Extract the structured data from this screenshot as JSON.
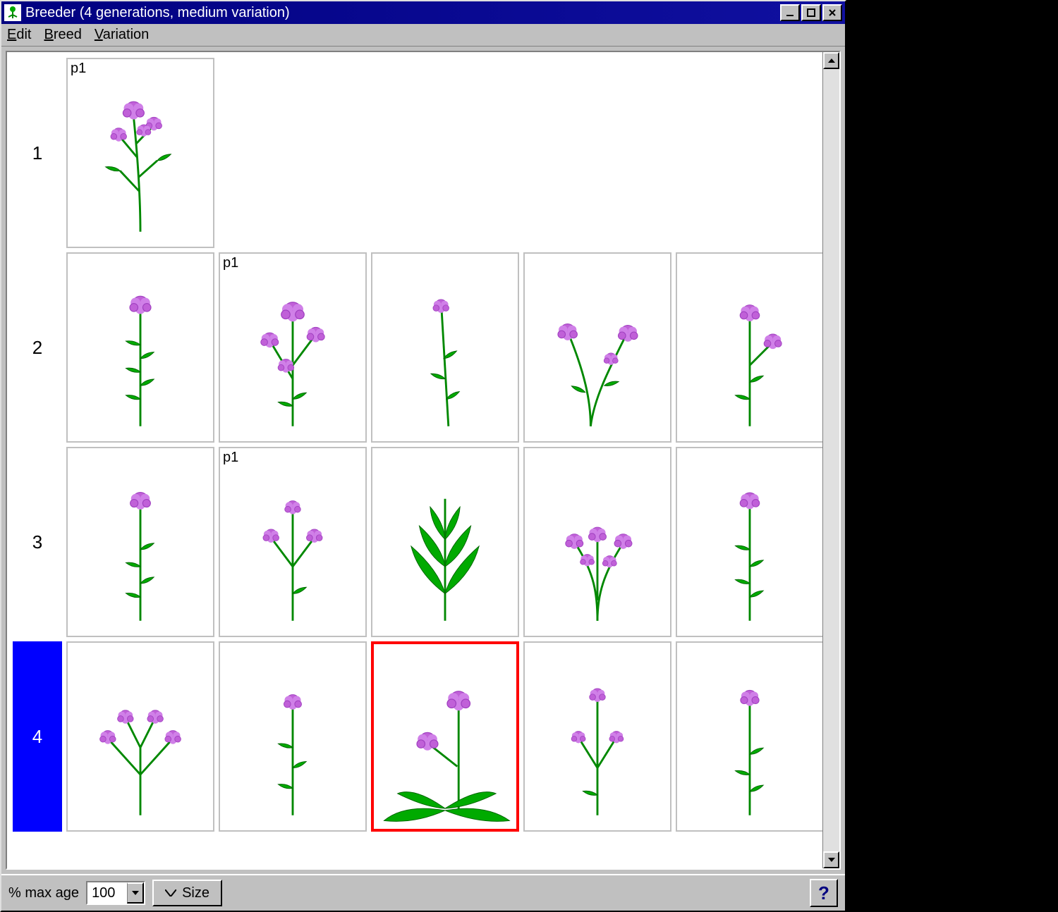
{
  "window": {
    "title": "Breeder (4 generations, medium variation)"
  },
  "menu": {
    "edit": "Edit",
    "breed": "Breed",
    "variation": "Variation"
  },
  "generations": [
    {
      "label": "1",
      "selected": false,
      "cells": [
        {
          "tag": "p1",
          "plant": "A",
          "selected": false
        },
        null,
        null,
        null,
        null
      ]
    },
    {
      "label": "2",
      "selected": false,
      "cells": [
        {
          "tag": "",
          "plant": "B",
          "selected": false
        },
        {
          "tag": "p1",
          "plant": "C",
          "selected": false
        },
        {
          "tag": "",
          "plant": "D",
          "selected": false
        },
        {
          "tag": "",
          "plant": "E",
          "selected": false
        },
        {
          "tag": "",
          "plant": "F",
          "selected": false
        }
      ]
    },
    {
      "label": "3",
      "selected": false,
      "cells": [
        {
          "tag": "",
          "plant": "G",
          "selected": false
        },
        {
          "tag": "p1",
          "plant": "H",
          "selected": false
        },
        {
          "tag": "",
          "plant": "I",
          "selected": false
        },
        {
          "tag": "",
          "plant": "J",
          "selected": false
        },
        {
          "tag": "",
          "plant": "K",
          "selected": false
        }
      ]
    },
    {
      "label": "4",
      "selected": true,
      "cells": [
        {
          "tag": "",
          "plant": "L",
          "selected": false
        },
        {
          "tag": "",
          "plant": "M",
          "selected": false
        },
        {
          "tag": "",
          "plant": "N",
          "selected": true
        },
        {
          "tag": "",
          "plant": "O",
          "selected": false
        },
        {
          "tag": "",
          "plant": "P",
          "selected": false
        }
      ]
    }
  ],
  "status": {
    "max_age_label": "% max age",
    "max_age_value": "100",
    "size_button": "Size",
    "help": "?"
  }
}
